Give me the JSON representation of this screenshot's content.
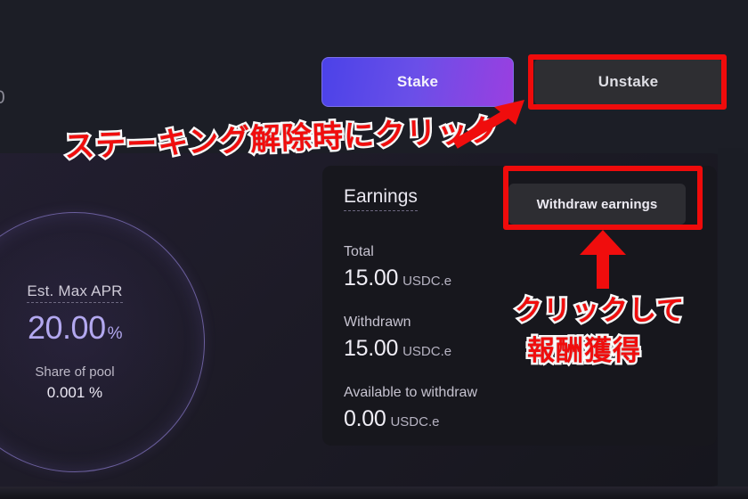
{
  "window": {
    "background_color": "#1b1d25",
    "panel_color": "#1d1b27"
  },
  "left_edge": {
    "cut_off_glyph": "0"
  },
  "actions": {
    "stake_label": "Stake",
    "unstake_label": "Unstake",
    "stake_gradient_from": "#4b42e8",
    "stake_gradient_to": "#9a3fe0"
  },
  "apr": {
    "label": "Est. Max APR",
    "value": "20.00",
    "percent_symbol": "%",
    "value_color": "#b3a8f0",
    "pool_label": "Share of pool",
    "pool_value": "0.001 %",
    "ring_color": "#6b5f9e"
  },
  "earnings": {
    "title": "Earnings",
    "withdraw_button_label": "Withdraw earnings",
    "stats": [
      {
        "key": "Total",
        "value": "15.00",
        "unit": "USDC.e"
      },
      {
        "key": "Withdrawn",
        "value": "15.00",
        "unit": "USDC.e"
      },
      {
        "key": "Available to withdraw",
        "value": "0.00",
        "unit": "USDC.e"
      }
    ]
  },
  "annotations": {
    "highlight_color": "#ef0b0b",
    "text_color": "#f00d0d",
    "outline_color": "#ffffff",
    "unstake_note": "ステーキング解除時にクリック",
    "withdraw_note_line1": "クリックして",
    "withdraw_note_line2": "報酬獲得"
  }
}
